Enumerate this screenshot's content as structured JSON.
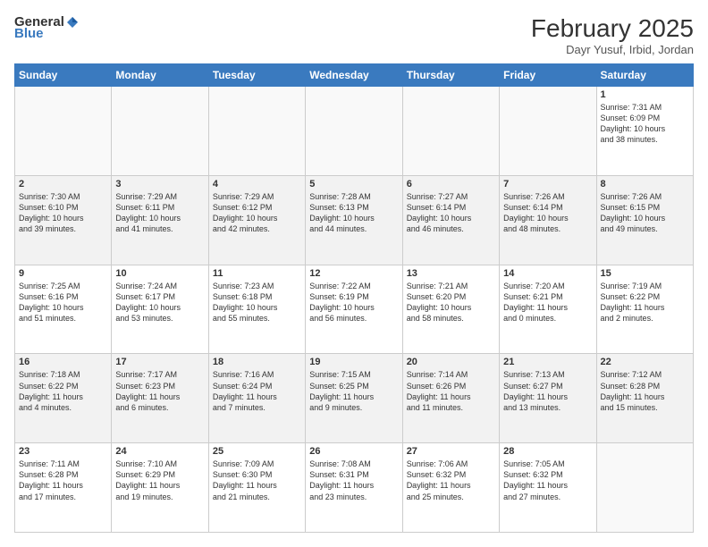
{
  "header": {
    "logo_general": "General",
    "logo_blue": "Blue",
    "month_title": "February 2025",
    "location": "Dayr Yusuf, Irbid, Jordan"
  },
  "days_of_week": [
    "Sunday",
    "Monday",
    "Tuesday",
    "Wednesday",
    "Thursday",
    "Friday",
    "Saturday"
  ],
  "weeks": [
    [
      {
        "day": "",
        "info": ""
      },
      {
        "day": "",
        "info": ""
      },
      {
        "day": "",
        "info": ""
      },
      {
        "day": "",
        "info": ""
      },
      {
        "day": "",
        "info": ""
      },
      {
        "day": "",
        "info": ""
      },
      {
        "day": "1",
        "info": "Sunrise: 7:31 AM\nSunset: 6:09 PM\nDaylight: 10 hours\nand 38 minutes."
      }
    ],
    [
      {
        "day": "2",
        "info": "Sunrise: 7:30 AM\nSunset: 6:10 PM\nDaylight: 10 hours\nand 39 minutes."
      },
      {
        "day": "3",
        "info": "Sunrise: 7:29 AM\nSunset: 6:11 PM\nDaylight: 10 hours\nand 41 minutes."
      },
      {
        "day": "4",
        "info": "Sunrise: 7:29 AM\nSunset: 6:12 PM\nDaylight: 10 hours\nand 42 minutes."
      },
      {
        "day": "5",
        "info": "Sunrise: 7:28 AM\nSunset: 6:13 PM\nDaylight: 10 hours\nand 44 minutes."
      },
      {
        "day": "6",
        "info": "Sunrise: 7:27 AM\nSunset: 6:14 PM\nDaylight: 10 hours\nand 46 minutes."
      },
      {
        "day": "7",
        "info": "Sunrise: 7:26 AM\nSunset: 6:14 PM\nDaylight: 10 hours\nand 48 minutes."
      },
      {
        "day": "8",
        "info": "Sunrise: 7:26 AM\nSunset: 6:15 PM\nDaylight: 10 hours\nand 49 minutes."
      }
    ],
    [
      {
        "day": "9",
        "info": "Sunrise: 7:25 AM\nSunset: 6:16 PM\nDaylight: 10 hours\nand 51 minutes."
      },
      {
        "day": "10",
        "info": "Sunrise: 7:24 AM\nSunset: 6:17 PM\nDaylight: 10 hours\nand 53 minutes."
      },
      {
        "day": "11",
        "info": "Sunrise: 7:23 AM\nSunset: 6:18 PM\nDaylight: 10 hours\nand 55 minutes."
      },
      {
        "day": "12",
        "info": "Sunrise: 7:22 AM\nSunset: 6:19 PM\nDaylight: 10 hours\nand 56 minutes."
      },
      {
        "day": "13",
        "info": "Sunrise: 7:21 AM\nSunset: 6:20 PM\nDaylight: 10 hours\nand 58 minutes."
      },
      {
        "day": "14",
        "info": "Sunrise: 7:20 AM\nSunset: 6:21 PM\nDaylight: 11 hours\nand 0 minutes."
      },
      {
        "day": "15",
        "info": "Sunrise: 7:19 AM\nSunset: 6:22 PM\nDaylight: 11 hours\nand 2 minutes."
      }
    ],
    [
      {
        "day": "16",
        "info": "Sunrise: 7:18 AM\nSunset: 6:22 PM\nDaylight: 11 hours\nand 4 minutes."
      },
      {
        "day": "17",
        "info": "Sunrise: 7:17 AM\nSunset: 6:23 PM\nDaylight: 11 hours\nand 6 minutes."
      },
      {
        "day": "18",
        "info": "Sunrise: 7:16 AM\nSunset: 6:24 PM\nDaylight: 11 hours\nand 7 minutes."
      },
      {
        "day": "19",
        "info": "Sunrise: 7:15 AM\nSunset: 6:25 PM\nDaylight: 11 hours\nand 9 minutes."
      },
      {
        "day": "20",
        "info": "Sunrise: 7:14 AM\nSunset: 6:26 PM\nDaylight: 11 hours\nand 11 minutes."
      },
      {
        "day": "21",
        "info": "Sunrise: 7:13 AM\nSunset: 6:27 PM\nDaylight: 11 hours\nand 13 minutes."
      },
      {
        "day": "22",
        "info": "Sunrise: 7:12 AM\nSunset: 6:28 PM\nDaylight: 11 hours\nand 15 minutes."
      }
    ],
    [
      {
        "day": "23",
        "info": "Sunrise: 7:11 AM\nSunset: 6:28 PM\nDaylight: 11 hours\nand 17 minutes."
      },
      {
        "day": "24",
        "info": "Sunrise: 7:10 AM\nSunset: 6:29 PM\nDaylight: 11 hours\nand 19 minutes."
      },
      {
        "day": "25",
        "info": "Sunrise: 7:09 AM\nSunset: 6:30 PM\nDaylight: 11 hours\nand 21 minutes."
      },
      {
        "day": "26",
        "info": "Sunrise: 7:08 AM\nSunset: 6:31 PM\nDaylight: 11 hours\nand 23 minutes."
      },
      {
        "day": "27",
        "info": "Sunrise: 7:06 AM\nSunset: 6:32 PM\nDaylight: 11 hours\nand 25 minutes."
      },
      {
        "day": "28",
        "info": "Sunrise: 7:05 AM\nSunset: 6:32 PM\nDaylight: 11 hours\nand 27 minutes."
      },
      {
        "day": "",
        "info": ""
      }
    ]
  ]
}
